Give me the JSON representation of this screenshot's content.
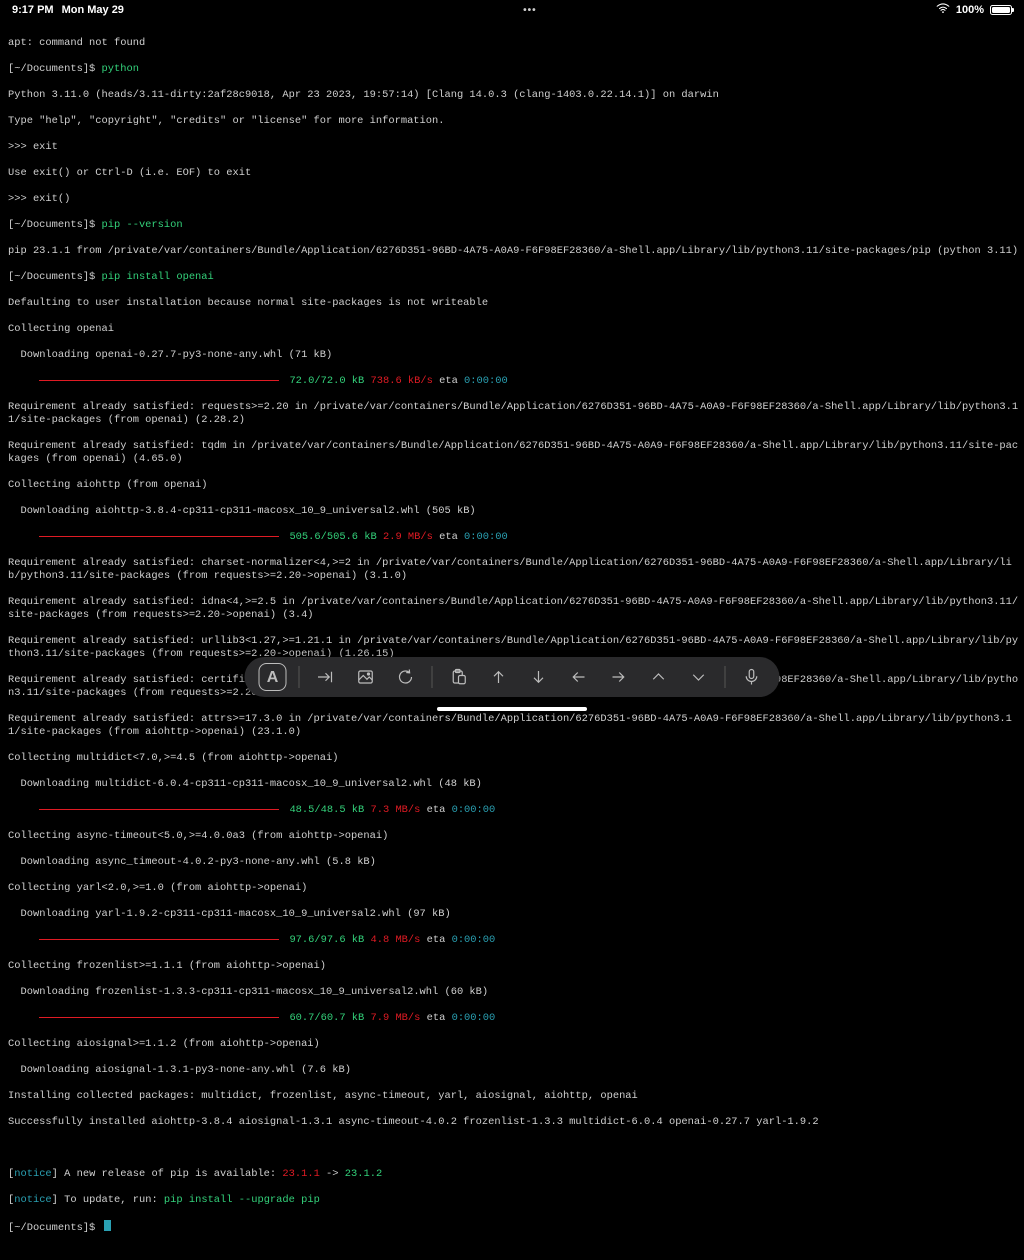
{
  "statusbar": {
    "time": "9:17 PM",
    "date": "Mon May 29",
    "center": "•••",
    "battery_pct": "100%"
  },
  "term": {
    "l01": "apt: command not found",
    "l02a": "[~/Documents]$ ",
    "l02b": "python",
    "l03": "Python 3.11.0 (heads/3.11-dirty:2af28c9018, Apr 23 2023, 19:57:14) [Clang 14.0.3 (clang-1403.0.22.14.1)] on darwin",
    "l04": "Type \"help\", \"copyright\", \"credits\" or \"license\" for more information.",
    "l05": ">>> exit",
    "l06": "Use exit() or Ctrl-D (i.e. EOF) to exit",
    "l07": ">>> exit()",
    "l08a": "[~/Documents]$ ",
    "l08b": "pip --version",
    "l09": "pip 23.1.1 from /private/var/containers/Bundle/Application/6276D351-96BD-4A75-A0A9-F6F98EF28360/a-Shell.app/Library/lib/python3.11/site-packages/pip (python 3.11)",
    "l10a": "[~/Documents]$ ",
    "l10b": "pip install openai",
    "l11": "Defaulting to user installation because normal site-packages is not writeable",
    "l12": "Collecting openai",
    "l13": "  Downloading openai-0.27.7-py3-none-any.whl (71 kB)",
    "p1a": "72.0/72.0 kB",
    "p1b": " 738.6 kB/s",
    "p1c": " eta ",
    "p1d": "0:00:00",
    "l14": "Requirement already satisfied: requests>=2.20 in /private/var/containers/Bundle/Application/6276D351-96BD-4A75-A0A9-F6F98EF28360/a-Shell.app/Library/lib/python3.11/site-packages (from openai) (2.28.2)",
    "l15": "Requirement already satisfied: tqdm in /private/var/containers/Bundle/Application/6276D351-96BD-4A75-A0A9-F6F98EF28360/a-Shell.app/Library/lib/python3.11/site-packages (from openai) (4.65.0)",
    "l16": "Collecting aiohttp (from openai)",
    "l17": "  Downloading aiohttp-3.8.4-cp311-cp311-macosx_10_9_universal2.whl (505 kB)",
    "p2a": "505.6/505.6 kB",
    "p2b": " 2.9 MB/s",
    "p2c": " eta ",
    "p2d": "0:00:00",
    "l18": "Requirement already satisfied: charset-normalizer<4,>=2 in /private/var/containers/Bundle/Application/6276D351-96BD-4A75-A0A9-F6F98EF28360/a-Shell.app/Library/lib/python3.11/site-packages (from requests>=2.20->openai) (3.1.0)",
    "l19": "Requirement already satisfied: idna<4,>=2.5 in /private/var/containers/Bundle/Application/6276D351-96BD-4A75-A0A9-F6F98EF28360/a-Shell.app/Library/lib/python3.11/site-packages (from requests>=2.20->openai) (3.4)",
    "l20": "Requirement already satisfied: urllib3<1.27,>=1.21.1 in /private/var/containers/Bundle/Application/6276D351-96BD-4A75-A0A9-F6F98EF28360/a-Shell.app/Library/lib/python3.11/site-packages (from requests>=2.20->openai) (1.26.15)",
    "l21": "Requirement already satisfied: certifi>=2017.4.17 in /private/var/containers/Bundle/Application/6276D351-96BD-4A75-A0A9-F6F98EF28360/a-Shell.app/Library/lib/python3.11/site-packages (from requests>=2.20->openai) (2022.12.7)",
    "l22": "Requirement already satisfied: attrs>=17.3.0 in /private/var/containers/Bundle/Application/6276D351-96BD-4A75-A0A9-F6F98EF28360/a-Shell.app/Library/lib/python3.11/site-packages (from aiohttp->openai) (23.1.0)",
    "l23": "Collecting multidict<7.0,>=4.5 (from aiohttp->openai)",
    "l24": "  Downloading multidict-6.0.4-cp311-cp311-macosx_10_9_universal2.whl (48 kB)",
    "p3a": "48.5/48.5 kB",
    "p3b": " 7.3 MB/s",
    "p3c": " eta ",
    "p3d": "0:00:00",
    "l25": "Collecting async-timeout<5.0,>=4.0.0a3 (from aiohttp->openai)",
    "l26": "  Downloading async_timeout-4.0.2-py3-none-any.whl (5.8 kB)",
    "l27": "Collecting yarl<2.0,>=1.0 (from aiohttp->openai)",
    "l28": "  Downloading yarl-1.9.2-cp311-cp311-macosx_10_9_universal2.whl (97 kB)",
    "p4a": "97.6/97.6 kB",
    "p4b": " 4.8 MB/s",
    "p4c": " eta ",
    "p4d": "0:00:00",
    "l29": "Collecting frozenlist>=1.1.1 (from aiohttp->openai)",
    "l30": "  Downloading frozenlist-1.3.3-cp311-cp311-macosx_10_9_universal2.whl (60 kB)",
    "p5a": "60.7/60.7 kB",
    "p5b": " 7.9 MB/s",
    "p5c": " eta ",
    "p5d": "0:00:00",
    "l31": "Collecting aiosignal>=1.1.2 (from aiohttp->openai)",
    "l32": "  Downloading aiosignal-1.3.1-py3-none-any.whl (7.6 kB)",
    "l33": "Installing collected packages: multidict, frozenlist, async-timeout, yarl, aiosignal, aiohttp, openai",
    "l34": "Successfully installed aiohttp-3.8.4 aiosignal-1.3.1 async-timeout-4.0.2 frozenlist-1.3.3 multidict-6.0.4 openai-0.27.7 yarl-1.9.2",
    "n1a": "[",
    "n1b": "notice",
    "n1c": "] A new release of pip is available: ",
    "n1d": "23.1.1",
    "n1e": " -> ",
    "n1f": "23.1.2",
    "n2a": "[",
    "n2b": "notice",
    "n2c": "] To update, run: ",
    "n2d": "pip install --upgrade pip",
    "l35": "[~/Documents]$ "
  }
}
